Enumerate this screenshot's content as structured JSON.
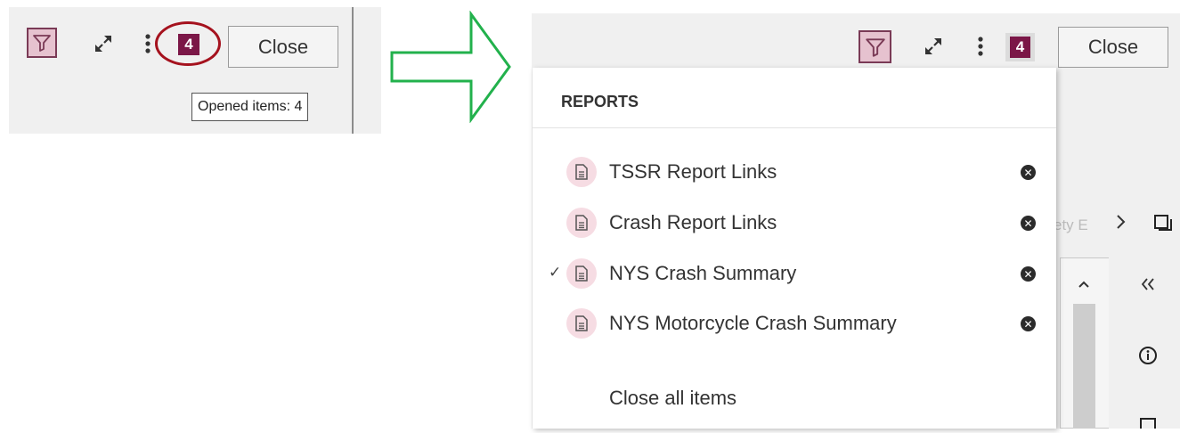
{
  "before": {
    "badge_count": "4",
    "close_label": "Close",
    "tooltip": "Opened items: 4"
  },
  "after": {
    "badge_count": "4",
    "close_label": "Close",
    "menu": {
      "header": "REPORTS",
      "items": [
        {
          "label": "TSSR Report Links",
          "checked": false
        },
        {
          "label": "Crash Report Links",
          "checked": false
        },
        {
          "label": "NYS Crash Summary",
          "checked": true
        },
        {
          "label": "NYS Motorcycle Crash Summary",
          "checked": false
        }
      ],
      "close_all": "Close all items"
    },
    "background": {
      "partial_text": "ety E",
      "chevron_right": "›",
      "collapse_glyph": "«"
    }
  },
  "colors": {
    "accent": "#7b1747",
    "filter_bg": "#e6c2cf",
    "arrow": "#22b14c",
    "highlight_ring": "#a5121e"
  },
  "icons": [
    "filter-icon",
    "expand-icon",
    "more-vertical-icon",
    "document-icon",
    "close-circle-icon",
    "checkmark-icon",
    "info-icon",
    "chevron-up-icon",
    "chevron-right-icon",
    "collapse-left-icon",
    "window-icon"
  ]
}
